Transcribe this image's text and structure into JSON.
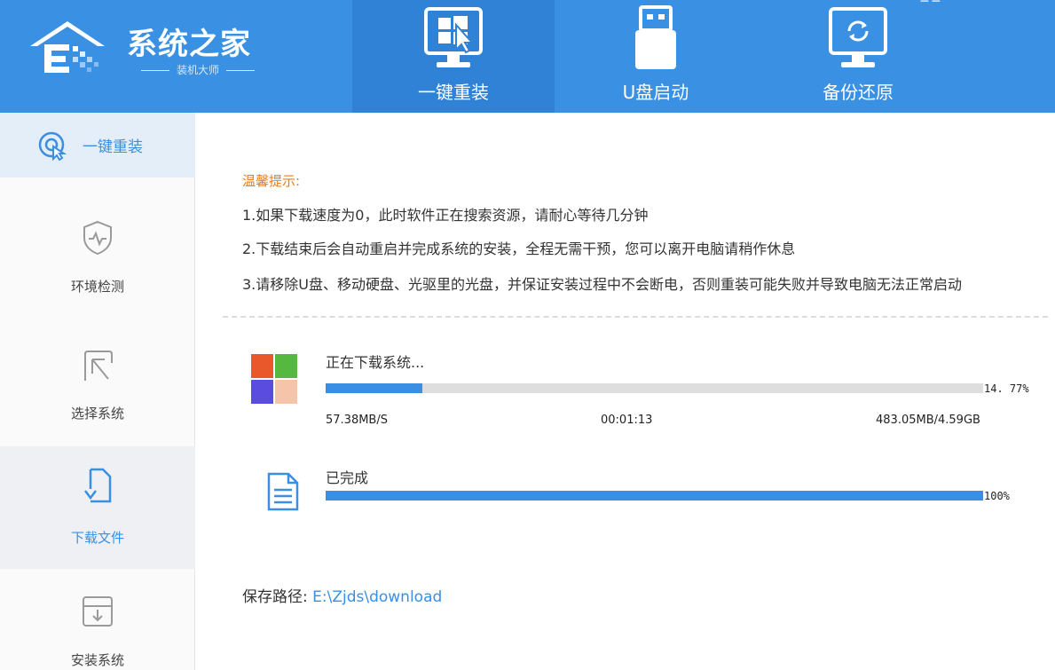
{
  "brand": {
    "title": "系统之家",
    "subtitle": "装机大师"
  },
  "corner_text": "─ ─",
  "nav": [
    {
      "label": "一键重装",
      "icon": "windows-monitor-icon",
      "active": true
    },
    {
      "label": "U盘启动",
      "icon": "usb-drive-icon",
      "active": false
    },
    {
      "label": "备份还原",
      "icon": "backup-restore-icon",
      "active": false
    }
  ],
  "sidebar": {
    "top": {
      "label": "一键重装",
      "icon": "one-click-icon"
    },
    "items": [
      {
        "label": "环境检测",
        "icon": "shield-check-icon"
      },
      {
        "label": "选择系统",
        "icon": "select-cursor-icon"
      },
      {
        "label": "下载文件",
        "icon": "file-download-icon",
        "active": true
      },
      {
        "label": "安装系统",
        "icon": "install-box-icon"
      }
    ]
  },
  "tips": {
    "title": "温馨提示:",
    "lines": [
      "1.如果下载速度为0，此时软件正在搜索资源，请耐心等待几分钟",
      "2.下载结束后会自动重启并完成系统的安装，全程无需干预，您可以离开电脑请稍作休息",
      "3.请移除U盘、移动硬盘、光驱里的光盘，并保证安装过程中不会断电，否则重装可能失败并导致电脑无法正常启动"
    ]
  },
  "download": {
    "title": "正在下载系统...",
    "percent_text": "14. 77%",
    "progress": 0.1477,
    "speed": "57.38MB/S",
    "elapsed": "00:01:13",
    "size": "483.05MB/4.59GB"
  },
  "completed": {
    "title": "已完成",
    "percent_text": "100%",
    "progress": 1.0
  },
  "save": {
    "label": "保存路径:",
    "path": "E:\\Zjds\\download"
  },
  "colors": {
    "header_bg": "#3a91e3",
    "active_tab": "#2f82d6",
    "accent": "#3a8fe2",
    "warning": "#f07b14"
  }
}
